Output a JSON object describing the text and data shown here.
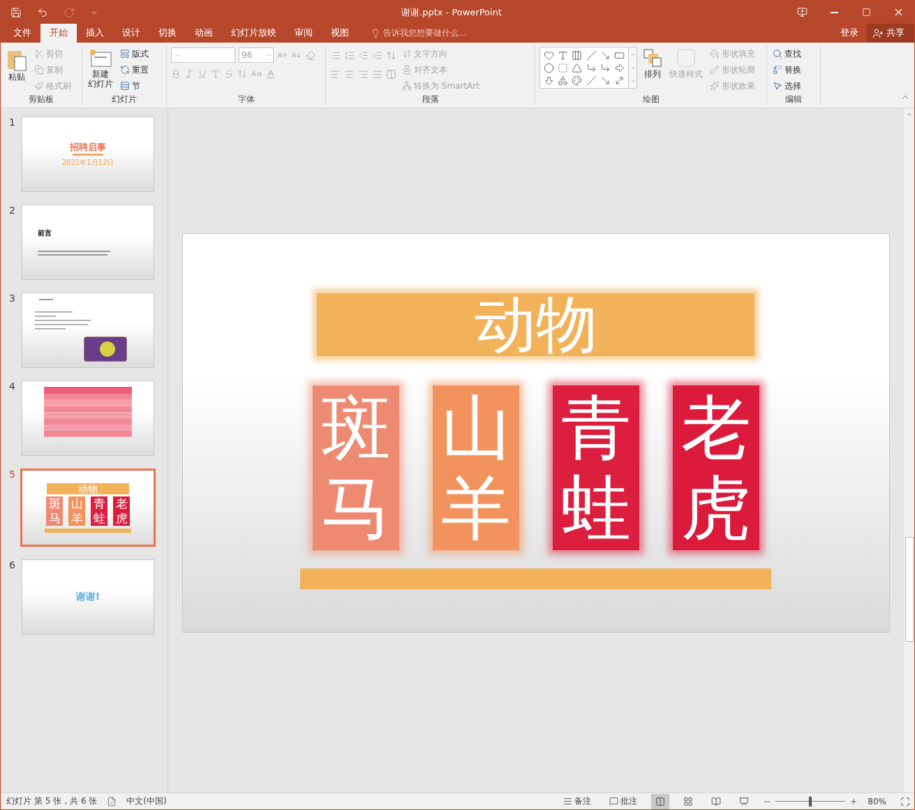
{
  "window": {
    "title": "谢谢.pptx - PowerPoint"
  },
  "menu_tabs": [
    {
      "label": "文件",
      "selected": false
    },
    {
      "label": "开始",
      "selected": true
    },
    {
      "label": "插入",
      "selected": false
    },
    {
      "label": "设计",
      "selected": false
    },
    {
      "label": "切换",
      "selected": false
    },
    {
      "label": "动画",
      "selected": false
    },
    {
      "label": "幻灯片放映",
      "selected": false
    },
    {
      "label": "审阅",
      "selected": false
    },
    {
      "label": "视图",
      "selected": false
    }
  ],
  "tell_me": {
    "placeholder": "告诉我您想要做什么..."
  },
  "account": {
    "sign_in": "登录",
    "share": "共享"
  },
  "ribbon": {
    "clipboard": {
      "paste": "粘贴",
      "items": [
        {
          "label": "剪切",
          "disabled": true
        },
        {
          "label": "复制",
          "disabled": true
        },
        {
          "label": "格式刷",
          "disabled": true
        }
      ],
      "label": "剪贴板"
    },
    "slides": {
      "new_slide": [
        "新建",
        "幻灯片"
      ],
      "items": [
        {
          "label": "版式"
        },
        {
          "label": "重置"
        },
        {
          "label": "节"
        }
      ],
      "label": "幻灯片"
    },
    "font": {
      "size": "96",
      "label": "字体"
    },
    "paragraph": {
      "items": [
        {
          "label": "文字方向"
        },
        {
          "label": "对齐文本"
        },
        {
          "label": "转换为 SmartArt"
        }
      ],
      "label": "段落"
    },
    "drawing": {
      "arrange": "排列",
      "quick_styles": "快速样式",
      "items": [
        {
          "label": "形状填充"
        },
        {
          "label": "形状轮廓"
        },
        {
          "label": "形状效果"
        }
      ],
      "label": "绘图"
    },
    "editing": {
      "items": [
        {
          "label": "查找"
        },
        {
          "label": "替换"
        },
        {
          "label": "选择"
        }
      ],
      "label": "编辑"
    }
  },
  "thumbnails": [
    {
      "number": "1",
      "selected": false,
      "kind": "title",
      "title": "招聘启事",
      "date": "2021年1月12日"
    },
    {
      "number": "2",
      "selected": false,
      "kind": "heading",
      "title": "前言"
    },
    {
      "number": "3",
      "selected": false,
      "kind": "text_image"
    },
    {
      "number": "4",
      "selected": false,
      "kind": "table"
    },
    {
      "number": "5",
      "selected": true,
      "kind": "animals",
      "title": "动物",
      "animals": [
        {
          "name": "斑马",
          "color": "#ef8a72"
        },
        {
          "name": "山羊",
          "color": "#f2935e"
        },
        {
          "name": "青蛙",
          "color": "#dc1f3f"
        },
        {
          "name": "老虎",
          "color": "#dc1a3c"
        }
      ]
    },
    {
      "number": "6",
      "selected": false,
      "kind": "thanks",
      "title": "谢谢!"
    }
  ],
  "slide": {
    "title": "动物",
    "animals": [
      {
        "name": "斑马",
        "color": "#ef8a72"
      },
      {
        "name": "山羊",
        "color": "#f2935e"
      },
      {
        "name": "青蛙",
        "color": "#dc1f3f"
      },
      {
        "name": "老虎",
        "color": "#dc1a3c"
      }
    ]
  },
  "status_bar": {
    "slide_info": "幻灯片 第 5 张，共 6 张",
    "language": "中文(中国)",
    "notes": "备注",
    "comments": "批注",
    "zoom": "80%",
    "zoom_level": {
      "level": 0.5
    }
  }
}
